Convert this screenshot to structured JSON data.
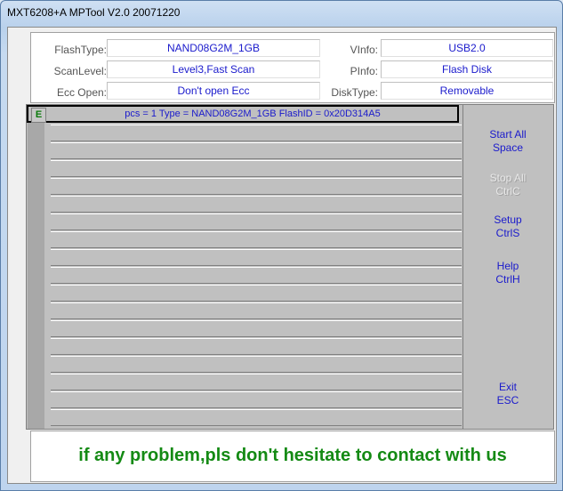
{
  "window": {
    "title": "MXT6208+A MPTool V2.0 20071220"
  },
  "info": {
    "flash_type": {
      "label": "FlashType:",
      "value": "NAND08G2M_1GB"
    },
    "scan_level": {
      "label": "ScanLevel:",
      "value": "Level3,Fast Scan"
    },
    "ecc_open": {
      "label": "Ecc Open:",
      "value": "Don't open Ecc"
    },
    "v_info": {
      "label": "VInfo:",
      "value": "USB2.0"
    },
    "p_info": {
      "label": "PInfo:",
      "value": "Flash Disk"
    },
    "disk_type": {
      "label": "DiskType:",
      "value": "Removable"
    }
  },
  "port": {
    "badge": "E",
    "text": "pcs = 1  Type = NAND08G2M_1GB  FlashID = 0x20D314A5"
  },
  "buttons": {
    "start": {
      "line1": "Start All",
      "line2": "Space"
    },
    "stop": {
      "line1": "Stop All",
      "line2": "CtrlC"
    },
    "setup": {
      "line1": "Setup",
      "line2": "CtrlS"
    },
    "help": {
      "line1": "Help",
      "line2": "CtrlH"
    },
    "exit": {
      "line1": "Exit",
      "line2": "ESC"
    }
  },
  "message": "if any problem,pls don't hesitate to contact with us"
}
